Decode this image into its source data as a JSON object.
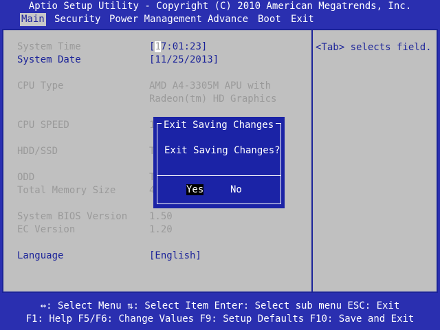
{
  "title": "Aptio Setup Utility - Copyright (C) 2010 American Megatrends, Inc.",
  "menu": [
    "Main",
    "Security",
    "Power Management",
    "Advance",
    "Boot",
    "Exit"
  ],
  "active_menu": "Main",
  "help": {
    "text": "<Tab> selects field."
  },
  "system_time": {
    "label": "System Time",
    "value_open": "[",
    "value_cursor": "1",
    "value_rest": "7:01:23]"
  },
  "system_date": {
    "label": "System Date",
    "value": "[11/25/2013]"
  },
  "cpu_type": {
    "label": "CPU Type",
    "value_line1": "AMD A4-3305M APU with",
    "value_line2": "Radeon(tm) HD Graphics"
  },
  "cpu_speed": {
    "label": "CPU SPEED",
    "value": "1"
  },
  "hdd": {
    "label": "HDD/SSD",
    "value": "T"
  },
  "odd": {
    "label": "ODD",
    "value": "T"
  },
  "memory": {
    "label": "Total Memory Size",
    "value": "4"
  },
  "bios_version": {
    "label": "System BIOS Version",
    "value": "1.50"
  },
  "ec_version": {
    "label": "EC Version",
    "value": "1.20"
  },
  "language": {
    "label": "Language",
    "value": "[English]"
  },
  "footer": {
    "line1": "↔: Select Menu ⇅: Select Item Enter: Select sub menu ESC: Exit",
    "line2": "F1: Help F5/F6: Change Values F9: Setup Defaults F10: Save and Exit"
  },
  "dialog": {
    "title": "Exit Saving Changes",
    "message": "Exit Saving Changes?",
    "yes": "Yes",
    "no": "No"
  },
  "colors": {
    "background": "#2a2fb0",
    "panel": "#c0c0c0",
    "accent": "#1b2399",
    "dim_text": "#9a9a9a"
  }
}
